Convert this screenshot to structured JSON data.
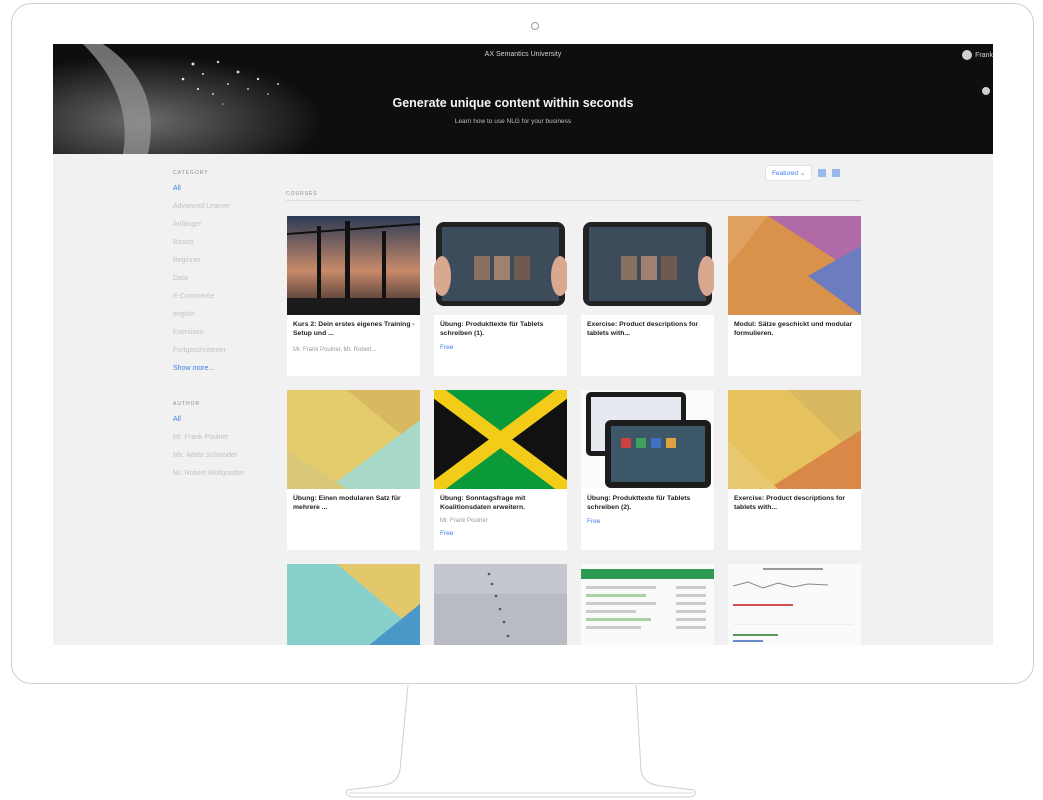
{
  "header": {
    "university": "AX Semantics University",
    "account": "Frank",
    "title": "Generate unique content within seconds",
    "subtitle": "Learn how to use NLG for your business"
  },
  "sidebar": {
    "category_heading": "CATEGORY",
    "categories": [
      "All",
      "Advanced Learner",
      "Anfänger",
      "Basics",
      "Beginner",
      "Data",
      "E-Commerce",
      "english",
      "Exercises",
      "Fortgeschrittener"
    ],
    "show_more": "Show more...",
    "author_heading": "AUTHOR",
    "authors": [
      "All",
      "Mr. Frank Poulner",
      "Ms. Adela Schneider",
      "Mr. Robert Wolfgrastler"
    ]
  },
  "main": {
    "section_label": "COURSES",
    "sort": "Featured",
    "cards": [
      {
        "title": "Kurs 2: Dein erstes eigenes Training - Setup und ...",
        "meta": "Mr. Frank Poulner, Mr. Robert...",
        "free": ""
      },
      {
        "title": "Übung: Produkttexte für Tablets schreiben (1).",
        "meta": "",
        "free": "Free"
      },
      {
        "title": "Exercise: Product descriptions for tablets with...",
        "meta": "",
        "free": ""
      },
      {
        "title": "Modul: Sätze geschickt und modular formulieren.",
        "meta": "",
        "free": ""
      },
      {
        "title": "Übung: Einen modularen Satz für mehrere ...",
        "meta": "",
        "free": ""
      },
      {
        "title": "Übung: Sonntagsfrage mit Koalitionsdaten erweitern.",
        "meta": "Mr. Frank Poulner",
        "free": "Free"
      },
      {
        "title": "Übung: Produkttexte für Tablets schreiben (2).",
        "meta": "",
        "free": "Free"
      },
      {
        "title": "Exercise: Product descriptions for tablets with...",
        "meta": "",
        "free": ""
      }
    ]
  },
  "colors": {
    "accent": "#3b7de8",
    "hero_bg": "#0e0e0e",
    "page_bg": "#f1f1f1"
  }
}
